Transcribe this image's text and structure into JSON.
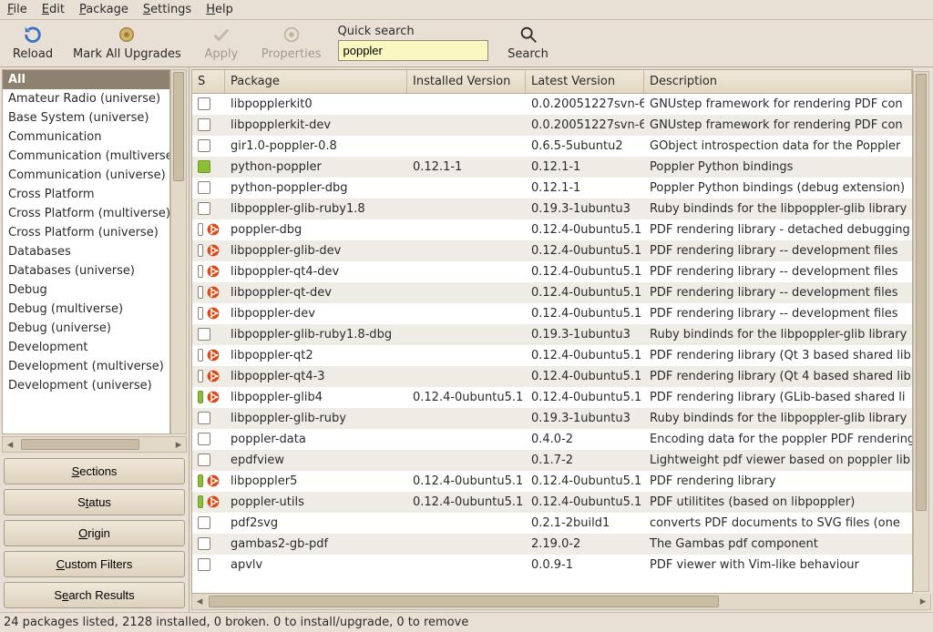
{
  "menu": {
    "file": "File",
    "edit": "Edit",
    "package": "Package",
    "settings": "Settings",
    "help": "Help"
  },
  "toolbar": {
    "reload": "Reload",
    "mark_all": "Mark All Upgrades",
    "apply": "Apply",
    "properties": "Properties",
    "quick_label": "Quick search",
    "quick_value": "poppler",
    "search": "Search"
  },
  "sidebar": {
    "categories": [
      "All",
      "Amateur Radio (universe)",
      "Base System (universe)",
      "Communication",
      "Communication (multiverse)",
      "Communication (universe)",
      "Cross Platform",
      "Cross Platform (multiverse)",
      "Cross Platform (universe)",
      "Databases",
      "Databases (universe)",
      "Debug",
      "Debug (multiverse)",
      "Debug (universe)",
      "Development",
      "Development (multiverse)",
      "Development (universe)"
    ],
    "selected_index": 0,
    "buttons": {
      "sections": "Sections",
      "status": "Status",
      "origin": "Origin",
      "custom_filters": "Custom Filters",
      "search_results": "Search Results"
    }
  },
  "table": {
    "headers": {
      "s": "S",
      "package": "Package",
      "installed": "Installed Version",
      "latest": "Latest Version",
      "description": "Description"
    },
    "rows": [
      {
        "installed_state": false,
        "ubuntu": false,
        "package": "libpopplerkit0",
        "installed": "",
        "latest": "0.0.20051227svn-6",
        "desc": "GNUstep framework for rendering PDF con"
      },
      {
        "installed_state": false,
        "ubuntu": false,
        "package": "libpopplerkit-dev",
        "installed": "",
        "latest": "0.0.20051227svn-6",
        "desc": "GNUstep framework for rendering PDF con"
      },
      {
        "installed_state": false,
        "ubuntu": false,
        "package": "gir1.0-poppler-0.8",
        "installed": "",
        "latest": "0.6.5-5ubuntu2",
        "desc": "GObject introspection data for the Poppler"
      },
      {
        "installed_state": true,
        "ubuntu": false,
        "package": "python-poppler",
        "installed": "0.12.1-1",
        "latest": "0.12.1-1",
        "desc": "Poppler Python bindings"
      },
      {
        "installed_state": false,
        "ubuntu": false,
        "package": "python-poppler-dbg",
        "installed": "",
        "latest": "0.12.1-1",
        "desc": "Poppler Python bindings (debug extension)"
      },
      {
        "installed_state": false,
        "ubuntu": false,
        "package": "libpoppler-glib-ruby1.8",
        "installed": "",
        "latest": "0.19.3-1ubuntu3",
        "desc": "Ruby bindinds for the libpoppler-glib library"
      },
      {
        "installed_state": false,
        "ubuntu": true,
        "package": "poppler-dbg",
        "installed": "",
        "latest": "0.12.4-0ubuntu5.1",
        "desc": "PDF rendering library - detached debugging"
      },
      {
        "installed_state": false,
        "ubuntu": true,
        "package": "libpoppler-glib-dev",
        "installed": "",
        "latest": "0.12.4-0ubuntu5.1",
        "desc": "PDF rendering library -- development files"
      },
      {
        "installed_state": false,
        "ubuntu": true,
        "package": "libpoppler-qt4-dev",
        "installed": "",
        "latest": "0.12.4-0ubuntu5.1",
        "desc": "PDF rendering library -- development files"
      },
      {
        "installed_state": false,
        "ubuntu": true,
        "package": "libpoppler-qt-dev",
        "installed": "",
        "latest": "0.12.4-0ubuntu5.1",
        "desc": "PDF rendering library -- development files"
      },
      {
        "installed_state": false,
        "ubuntu": true,
        "package": "libpoppler-dev",
        "installed": "",
        "latest": "0.12.4-0ubuntu5.1",
        "desc": "PDF rendering library -- development files"
      },
      {
        "installed_state": false,
        "ubuntu": false,
        "package": "libpoppler-glib-ruby1.8-dbg",
        "installed": "",
        "latest": "0.19.3-1ubuntu3",
        "desc": "Ruby bindinds for the libpoppler-glib library"
      },
      {
        "installed_state": false,
        "ubuntu": true,
        "package": "libpoppler-qt2",
        "installed": "",
        "latest": "0.12.4-0ubuntu5.1",
        "desc": "PDF rendering library (Qt 3 based shared lib"
      },
      {
        "installed_state": false,
        "ubuntu": true,
        "package": "libpoppler-qt4-3",
        "installed": "",
        "latest": "0.12.4-0ubuntu5.1",
        "desc": "PDF rendering library (Qt 4 based shared lib"
      },
      {
        "installed_state": true,
        "ubuntu": true,
        "package": "libpoppler-glib4",
        "installed": "0.12.4-0ubuntu5.1",
        "latest": "0.12.4-0ubuntu5.1",
        "desc": "PDF rendering library (GLib-based shared li"
      },
      {
        "installed_state": false,
        "ubuntu": false,
        "package": "libpoppler-glib-ruby",
        "installed": "",
        "latest": "0.19.3-1ubuntu3",
        "desc": "Ruby bindinds for the libpoppler-glib library"
      },
      {
        "installed_state": false,
        "ubuntu": false,
        "package": "poppler-data",
        "installed": "",
        "latest": "0.4.0-2",
        "desc": "Encoding data for the poppler PDF rendering"
      },
      {
        "installed_state": false,
        "ubuntu": false,
        "package": "epdfview",
        "installed": "",
        "latest": "0.1.7-2",
        "desc": "Lightweight pdf viewer based on poppler lib"
      },
      {
        "installed_state": true,
        "ubuntu": true,
        "package": "libpoppler5",
        "installed": "0.12.4-0ubuntu5.1",
        "latest": "0.12.4-0ubuntu5.1",
        "desc": "PDF rendering library"
      },
      {
        "installed_state": true,
        "ubuntu": true,
        "package": "poppler-utils",
        "installed": "0.12.4-0ubuntu5.1",
        "latest": "0.12.4-0ubuntu5.1",
        "desc": "PDF utilitites (based on libpoppler)"
      },
      {
        "installed_state": false,
        "ubuntu": false,
        "package": "pdf2svg",
        "installed": "",
        "latest": "0.2.1-2build1",
        "desc": "converts PDF documents to SVG files (one"
      },
      {
        "installed_state": false,
        "ubuntu": false,
        "package": "gambas2-gb-pdf",
        "installed": "",
        "latest": "2.19.0-2",
        "desc": "The Gambas pdf component"
      },
      {
        "installed_state": false,
        "ubuntu": false,
        "package": "apvlv",
        "installed": "",
        "latest": "0.0.9-1",
        "desc": "PDF viewer with Vim-like behaviour"
      }
    ]
  },
  "statusbar": "24 packages listed, 2128 installed, 0 broken. 0 to install/upgrade, 0 to remove"
}
